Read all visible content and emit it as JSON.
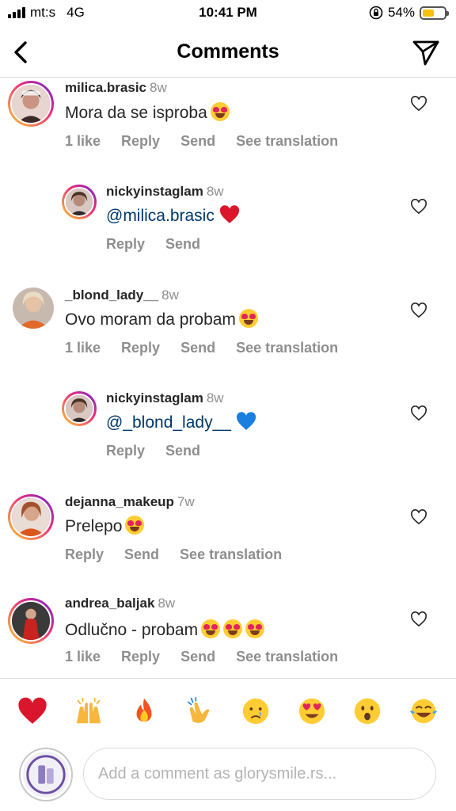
{
  "status_bar": {
    "carrier": "mt:s",
    "network": "4G",
    "time": "10:41 PM",
    "battery": "54%",
    "battery_level": 0.54,
    "battery_color": "#f4c20d"
  },
  "header": {
    "back_icon": "chevron-left-icon",
    "title": "Comments",
    "share_icon": "paper-plane-icon"
  },
  "comments": [
    {
      "username": "milica.brasic",
      "time": "8w",
      "text": "Mora da se isproba",
      "emoji": "heart-eyes",
      "likes": "1 like",
      "reply": "Reply",
      "send": "Send",
      "translate": "See translation"
    },
    {
      "username": "nickyinstaglam",
      "time": "8w",
      "mention": "@milica.brasic",
      "emoji": "red-heart",
      "reply": "Reply",
      "send": "Send"
    },
    {
      "username": "_blond_lady__",
      "time": "8w",
      "text": "Ovo moram da probam",
      "emoji": "heart-eyes",
      "likes": "1 like",
      "reply": "Reply",
      "send": "Send",
      "translate": "See translation"
    },
    {
      "username": "nickyinstaglam",
      "time": "8w",
      "mention": "@_blond_lady__",
      "emoji": "blue-heart",
      "reply": "Reply",
      "send": "Send"
    },
    {
      "username": "dejanna_makeup",
      "time": "7w",
      "text": "Prelepo",
      "emoji": "heart-eyes",
      "reply": "Reply",
      "send": "Send",
      "translate": "See translation"
    },
    {
      "username": "andrea_baljak",
      "time": "8w",
      "text": "Odlučno - probam",
      "emoji": "heart-eyes x3",
      "likes": "1 like",
      "reply": "Reply",
      "send": "Send",
      "translate": "See translation"
    }
  ],
  "reactions": [
    "red-heart",
    "raising-hands",
    "fire",
    "clapping-hands",
    "crying-face",
    "heart-eyes",
    "surprised-face",
    "tears-of-joy"
  ],
  "composer": {
    "placeholder": "Add a comment as glorysmile.rs..."
  }
}
